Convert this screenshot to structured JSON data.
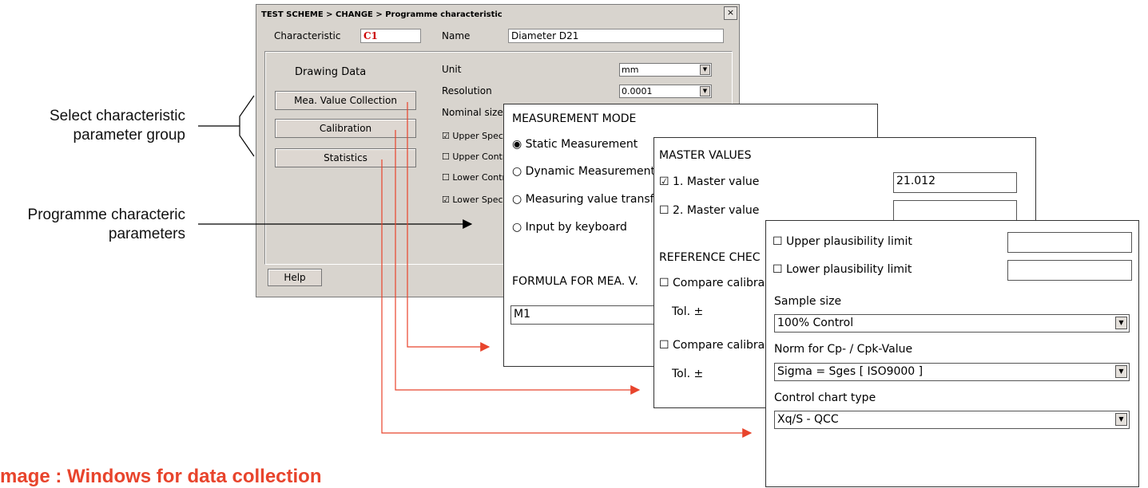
{
  "annotations": {
    "select_group": "Select characteristic\nparameter group",
    "programme_params": "Programme characteric\nparameters",
    "caption": "mage :  Windows for data collection"
  },
  "dialog": {
    "title": "TEST SCHEME > CHANGE > Programme characteristic",
    "close": "×",
    "characteristic_label": "Characteristic",
    "characteristic_value": "C1",
    "name_label": "Name",
    "name_value": "Diameter D21",
    "drawing_data_label": "Drawing Data",
    "buttons": [
      "Mea. Value Collection",
      "Calibration",
      "Statistics"
    ],
    "unit_label": "Unit",
    "unit_value": "mm",
    "resolution_label": "Resolution",
    "resolution_value": "0.0001",
    "nominal_label": "Nominal size",
    "checks": [
      {
        "label": "Upper Spec",
        "checked": true
      },
      {
        "label": "Upper Contr",
        "checked": false
      },
      {
        "label": "Lower Contr",
        "checked": false
      },
      {
        "label": "Lower Spec",
        "checked": true
      }
    ],
    "help": "Help"
  },
  "mode_window": {
    "heading": "MEASUREMENT MODE",
    "options": [
      {
        "label": "Static Measurement",
        "selected": true
      },
      {
        "label": "Dynamic Measurement",
        "selected": false
      },
      {
        "label": "Measuring value transfe",
        "selected": false
      },
      {
        "label": "Input by keyboard",
        "selected": false
      }
    ],
    "formula_heading": "FORMULA FOR MEA. V.",
    "formula_value": "M1"
  },
  "master_window": {
    "heading": "MASTER VALUES",
    "master1_label": "1. Master value",
    "master1_checked": true,
    "master1_value": "21.012",
    "master2_label": "2. Master value",
    "master2_checked": false,
    "master2_value": "",
    "ref_heading": "REFERENCE CHEC",
    "compare1": "Compare calibra",
    "tol1": "Tol. ±",
    "compare2": "Compare calibra",
    "tol2": "Tol. ±"
  },
  "stats_window": {
    "upper_limit": "Upper plausibility limit",
    "upper_value": "",
    "lower_limit": "Lower plausibility limit",
    "lower_value": "",
    "sample_label": "Sample size",
    "sample_value": "100% Control",
    "norm_label": "Norm for Cp- / Cpk-Value",
    "norm_value": "Sigma = Sges  [ ISO9000 ]",
    "chart_label": "Control chart type",
    "chart_value": "Xq/S - QCC"
  },
  "colors": {
    "accent": "#e8442c",
    "dialog_bg": "#d8d4ce",
    "char_code": "#cc0000"
  }
}
